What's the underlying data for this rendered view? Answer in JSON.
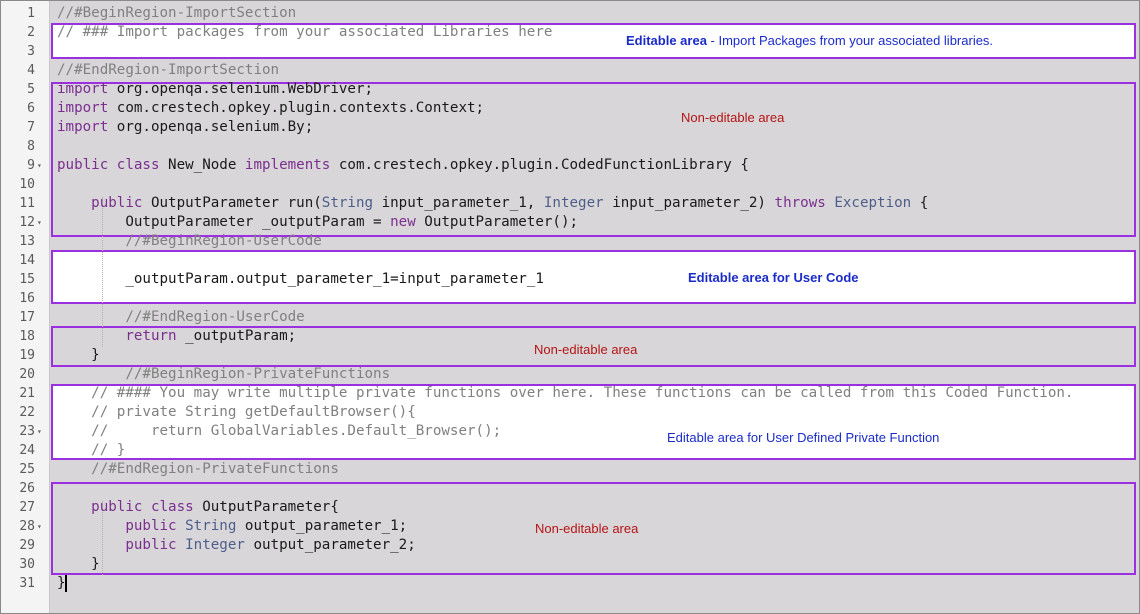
{
  "lines": [
    {
      "n": "1",
      "fold": false,
      "html": "<span class='c'>//#BeginRegion-ImportSection</span>"
    },
    {
      "n": "2",
      "fold": false,
      "html": "<span class='c'>// ### Import packages from your associated Libraries here</span>"
    },
    {
      "n": "3",
      "fold": false,
      "html": ""
    },
    {
      "n": "4",
      "fold": false,
      "html": "<span class='c'>//#EndRegion-ImportSection</span>"
    },
    {
      "n": "5",
      "fold": false,
      "html": "<span class='k'>import</span> org.openqa.selenium.WebDriver;"
    },
    {
      "n": "6",
      "fold": false,
      "html": "<span class='k'>import</span> com.crestech.opkey.plugin.contexts.Context;"
    },
    {
      "n": "7",
      "fold": false,
      "html": "<span class='k'>import</span> org.openqa.selenium.By;"
    },
    {
      "n": "8",
      "fold": false,
      "html": ""
    },
    {
      "n": "9",
      "fold": true,
      "html": "<span class='k'>public class</span> New_Node <span class='k'>implements</span> com.crestech.opkey.plugin.CodedFunctionLibrary {"
    },
    {
      "n": "10",
      "fold": false,
      "html": ""
    },
    {
      "n": "11",
      "fold": false,
      "html": "    <span class='k'>public</span> OutputParameter run(<span class='t'>String</span> input_parameter_1, <span class='t'>Integer</span> input_parameter_2) <span class='k'>throws</span> <span class='t'>Exception</span> {"
    },
    {
      "n": "12",
      "fold": true,
      "html": "        OutputParameter _outputParam = <span class='k'>new</span> OutputParameter();"
    },
    {
      "n": "13",
      "fold": false,
      "html": "        <span class='c'>//#BeginRegion-UserCode</span>"
    },
    {
      "n": "14",
      "fold": false,
      "html": ""
    },
    {
      "n": "15",
      "fold": false,
      "html": "        _outputParam.output_parameter_1=input_parameter_1"
    },
    {
      "n": "16",
      "fold": false,
      "html": ""
    },
    {
      "n": "17",
      "fold": false,
      "html": "        <span class='c'>//#EndRegion-UserCode</span>"
    },
    {
      "n": "18",
      "fold": false,
      "html": "        <span class='k'>return</span> _outputParam;"
    },
    {
      "n": "19",
      "fold": false,
      "html": "    }"
    },
    {
      "n": "20",
      "fold": false,
      "html": "        <span class='c'>//#BeginRegion-PrivateFunctions</span>"
    },
    {
      "n": "21",
      "fold": false,
      "html": "    <span class='c'>// #### You may write multiple private functions over here. These functions can be called from this Coded Function.</span>"
    },
    {
      "n": "22",
      "fold": false,
      "html": "    <span class='c'>// private String getDefaultBrowser(){</span>"
    },
    {
      "n": "23",
      "fold": true,
      "html": "    <span class='c'>//     return GlobalVariables.Default_Browser();</span>"
    },
    {
      "n": "24",
      "fold": false,
      "html": "    <span class='c'>// }</span>"
    },
    {
      "n": "25",
      "fold": false,
      "html": "    <span class='c'>//#EndRegion-PrivateFunctions</span>"
    },
    {
      "n": "26",
      "fold": false,
      "html": ""
    },
    {
      "n": "27",
      "fold": false,
      "html": "    <span class='k'>public class</span> OutputParameter{"
    },
    {
      "n": "28",
      "fold": true,
      "html": "        <span class='k'>public</span> <span class='t'>String</span> output_parameter_1;"
    },
    {
      "n": "29",
      "fold": false,
      "html": "        <span class='k'>public</span> <span class='t'>Integer</span> output_parameter_2;"
    },
    {
      "n": "30",
      "fold": false,
      "html": "    }"
    },
    {
      "n": "31",
      "fold": false,
      "html": "}"
    }
  ],
  "annotations": {
    "import_bold": "Editable area",
    "import_rest": " - Import Packages from your associated libraries.",
    "noneditable_1": "Non-editable area",
    "usercode": "Editable area for User Code",
    "noneditable_2": "Non-editable area",
    "private_fn": "Editable area for User Defined Private Function",
    "noneditable_3": "Non-editable area"
  },
  "colors": {
    "region_border": "#9b30e0",
    "editable_label": "#1a2bc8",
    "noneditable_label": "#b51414"
  }
}
